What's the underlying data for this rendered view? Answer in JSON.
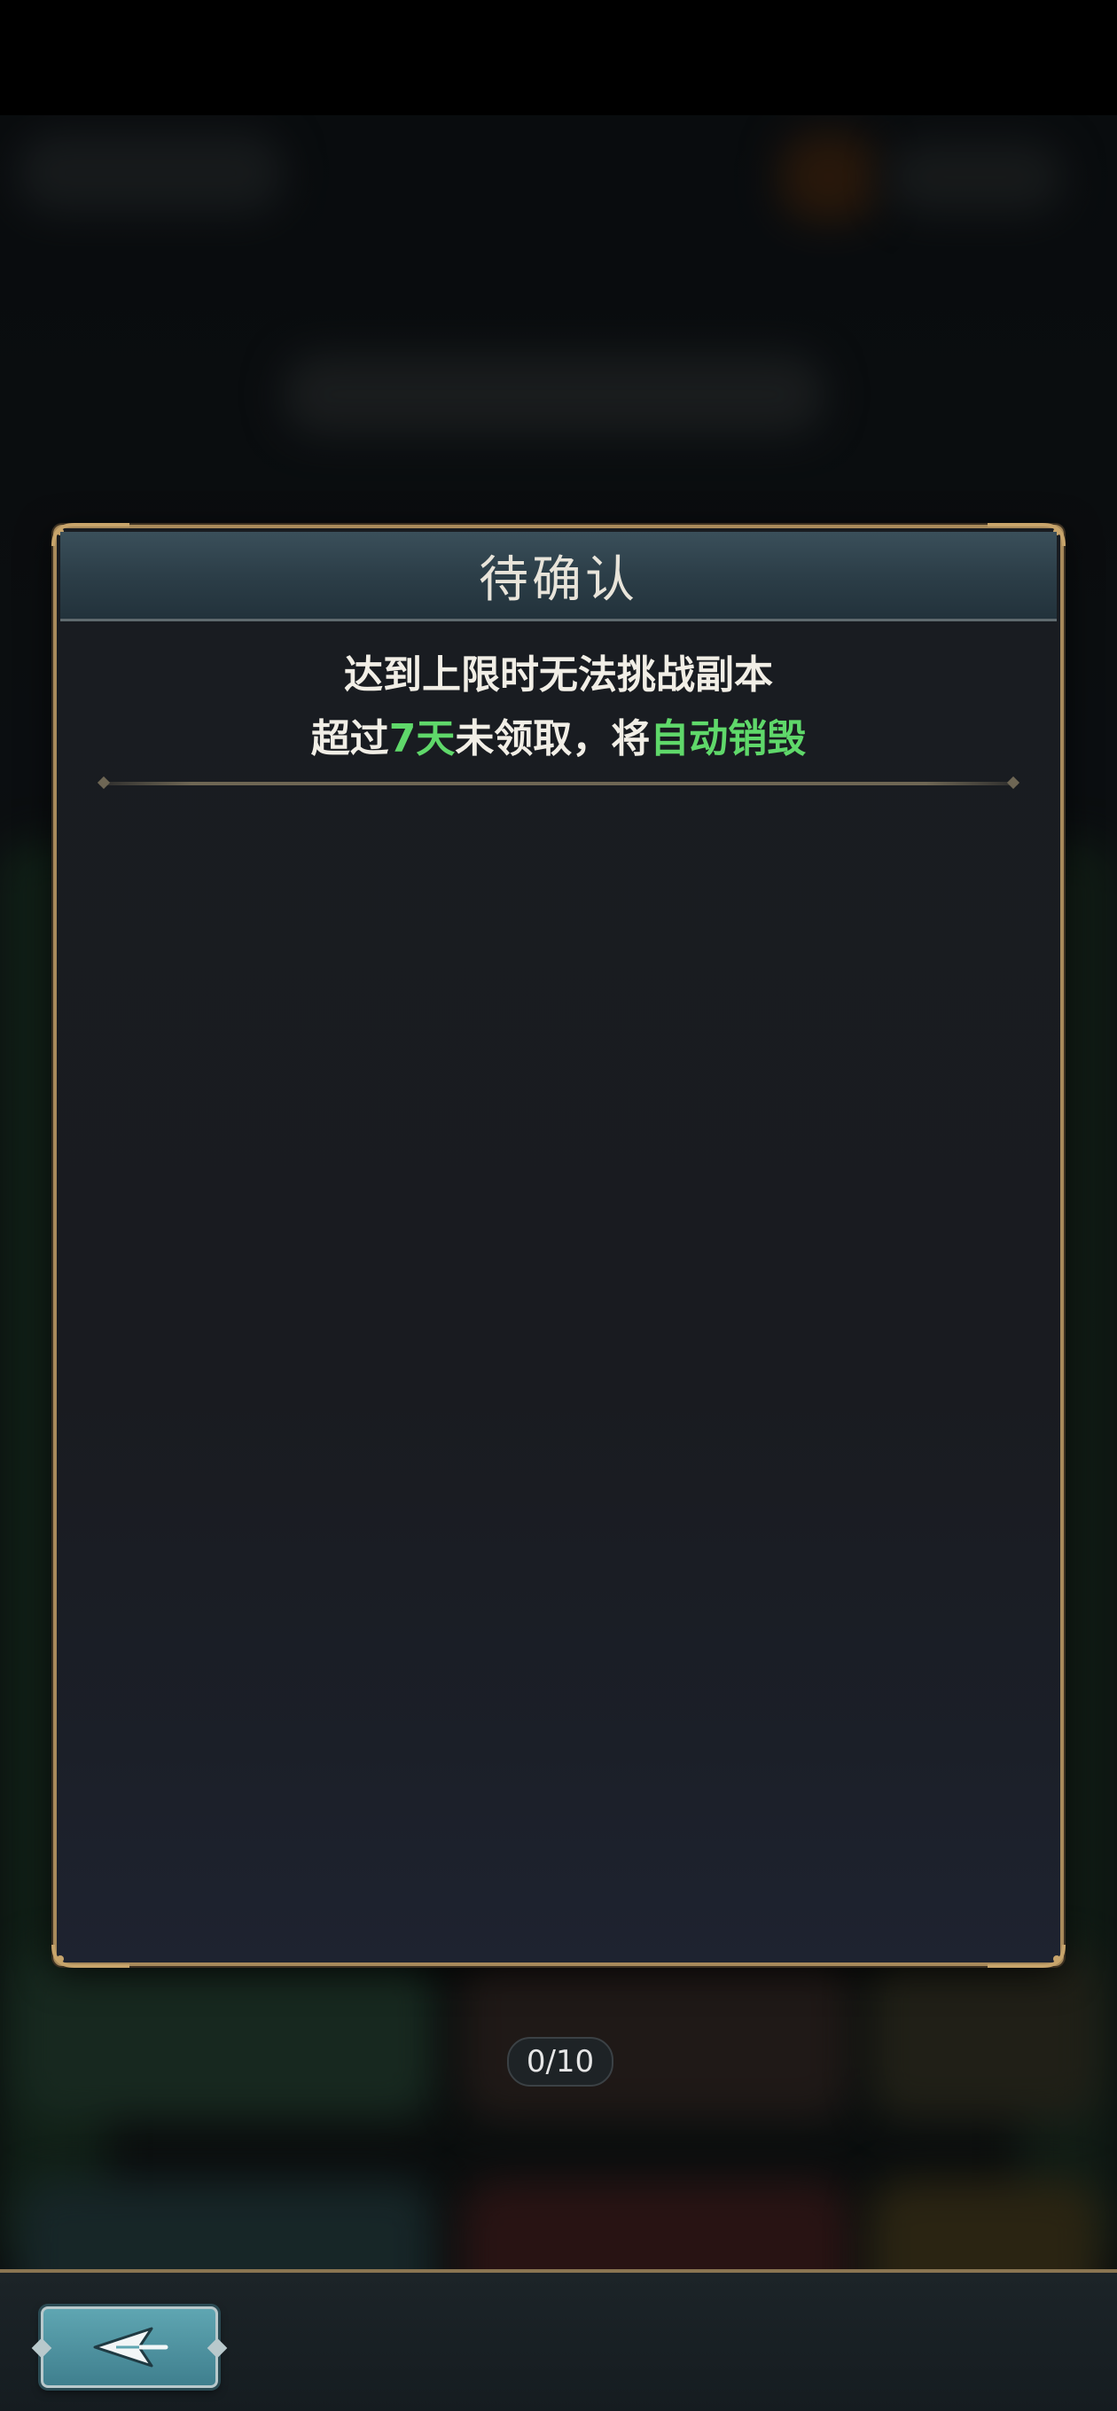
{
  "modal": {
    "title": "待确认",
    "notice_line1": "达到上限时无法挑战副本",
    "notice_line2_part1": "超过",
    "notice_line2_days": "7天",
    "notice_line2_part2": "未领取，将",
    "notice_line2_highlight": "自动销毁"
  },
  "pagination": {
    "counter": "0/10"
  },
  "navigation": {
    "back_icon": "back-arrow-icon"
  },
  "colors": {
    "highlight": "#5fd86a",
    "frame_gold": "#a88a5b",
    "header_teal": "#2c3e48",
    "back_button": "#4f93a0"
  }
}
